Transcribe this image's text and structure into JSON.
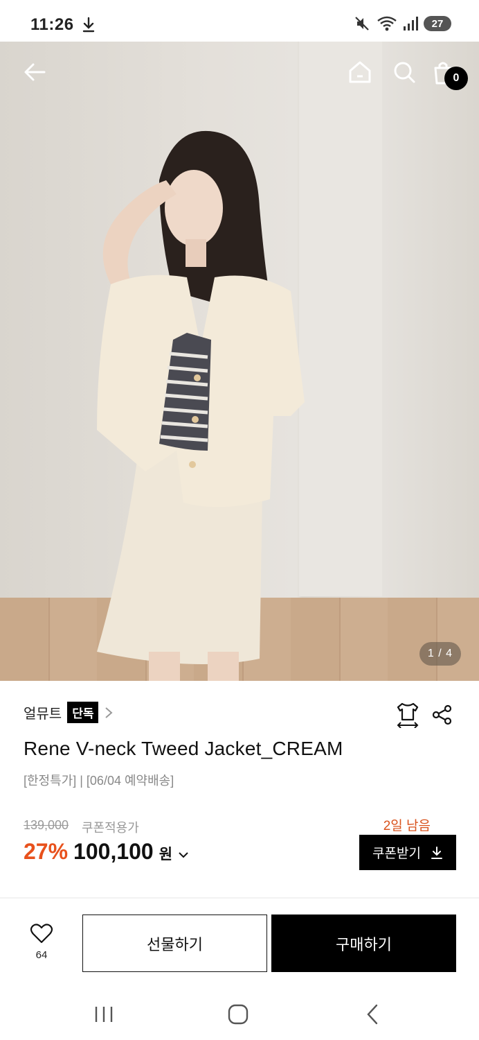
{
  "status_bar": {
    "time": "11:26",
    "battery": "27",
    "icons": [
      "download-icon",
      "mute-icon",
      "wifi-icon",
      "signal-icon",
      "battery-icon"
    ]
  },
  "hero": {
    "cart_count": "0",
    "page_indicator": "1 / 4",
    "icons": [
      "back-arrow-icon",
      "home-icon",
      "search-icon",
      "shopping-bag-icon"
    ]
  },
  "product": {
    "brand": "얼뮤트",
    "exclusive_badge": "단독",
    "title": "Rene V-neck Tweed Jacket_CREAM",
    "tags": "[한정특가] | [06/04 예약배송]",
    "original_price": "139,000",
    "coupon_price_label": "쿠폰적용가",
    "discount_rate": "27%",
    "sale_price": "100,100",
    "currency": "원",
    "days_left": "2일 남음",
    "coupon_button": "쿠폰받기"
  },
  "bottom_bar": {
    "wish_count": "64",
    "gift_button": "선물하기",
    "buy_button": "구매하기"
  },
  "colors": {
    "accent": "#e8511c",
    "primary": "#000000"
  }
}
